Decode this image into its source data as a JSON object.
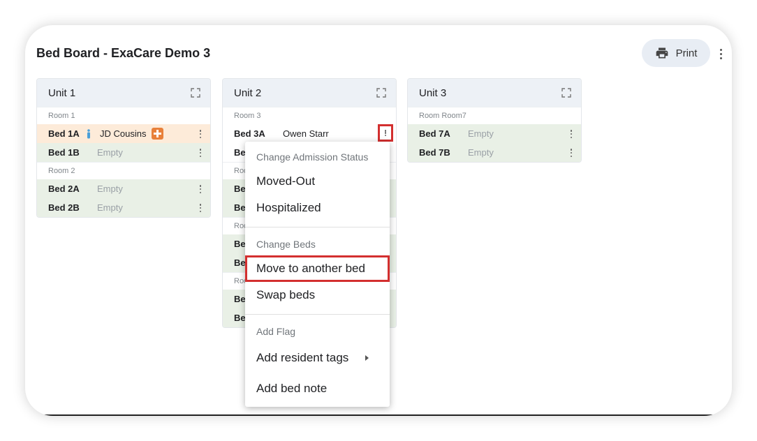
{
  "page": {
    "title": "Bed Board - ExaCare Demo 3",
    "print_label": "Print"
  },
  "units": [
    {
      "name": "Unit 1",
      "rooms": [
        {
          "label": "Room 1",
          "beds": [
            {
              "bed": "Bed 1A",
              "resident": "JD Cousins"
            },
            {
              "bed": "Bed 1B",
              "status": "Empty"
            }
          ]
        },
        {
          "label": "Room 2",
          "beds": [
            {
              "bed": "Bed 2A",
              "status": "Empty"
            },
            {
              "bed": "Bed 2B",
              "status": "Empty"
            }
          ]
        }
      ]
    },
    {
      "name": "Unit 2",
      "rooms": [
        {
          "label": "Room 3",
          "beds": [
            {
              "bed": "Bed 3A",
              "resident": "Owen Starr"
            },
            {
              "bed": "Be"
            }
          ]
        },
        {
          "label": "Roo",
          "beds": [
            {
              "bed": "Be"
            },
            {
              "bed": "Be"
            }
          ]
        },
        {
          "label": "Roo",
          "beds": [
            {
              "bed": "Be"
            },
            {
              "bed": "Be"
            }
          ]
        },
        {
          "label": "Roo",
          "beds": [
            {
              "bed": "Be"
            },
            {
              "bed": "Be"
            }
          ]
        }
      ]
    },
    {
      "name": "Unit 3",
      "rooms": [
        {
          "label": "Room Room7",
          "beds": [
            {
              "bed": "Bed 7A",
              "status": "Empty"
            },
            {
              "bed": "Bed 7B",
              "status": "Empty"
            }
          ]
        }
      ]
    }
  ],
  "menu": {
    "section_admission": "Change Admission Status",
    "moved_out": "Moved-Out",
    "hospitalized": "Hospitalized",
    "section_beds": "Change Beds",
    "move_bed": "Move to another bed",
    "swap_beds": "Swap beds",
    "section_flag": "Add Flag",
    "resident_tags": "Add resident tags",
    "bed_note": "Add bed note"
  },
  "colors": {
    "accent_highlight": "#d32f2f",
    "empty_row": "#e9f0e6",
    "occupied_row": "#fdebd9",
    "header_bg": "#edf1f6"
  }
}
